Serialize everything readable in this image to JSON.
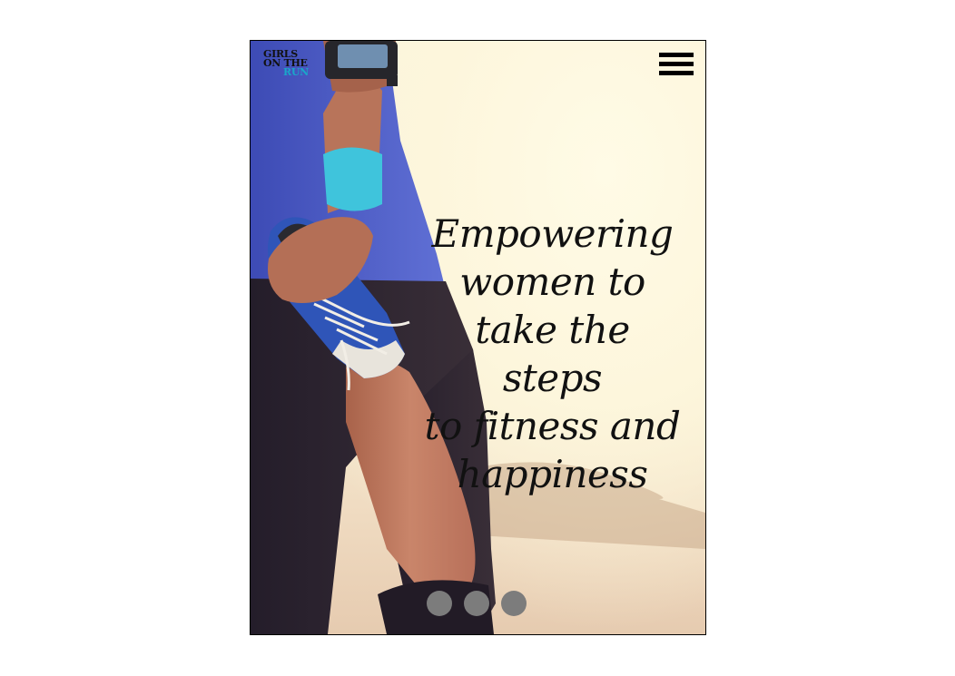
{
  "brand": {
    "logo_line1": "GIRLS",
    "logo_line2": "ON THE",
    "logo_line3": "RUN"
  },
  "colors": {
    "logo_accent": "#1aa6c9",
    "wristband": "#3fc4dc",
    "tank_top": "#4f5fc7",
    "dots": "#7c7c7c"
  },
  "header": {
    "menu_icon": "hamburger-menu-icon"
  },
  "hero": {
    "image": "runner-stretching-photo",
    "headline_lines": [
      "Empowering",
      "women to",
      "take the steps",
      "to fitness and",
      "happiness"
    ]
  },
  "carousel": {
    "dot_count": 3
  }
}
